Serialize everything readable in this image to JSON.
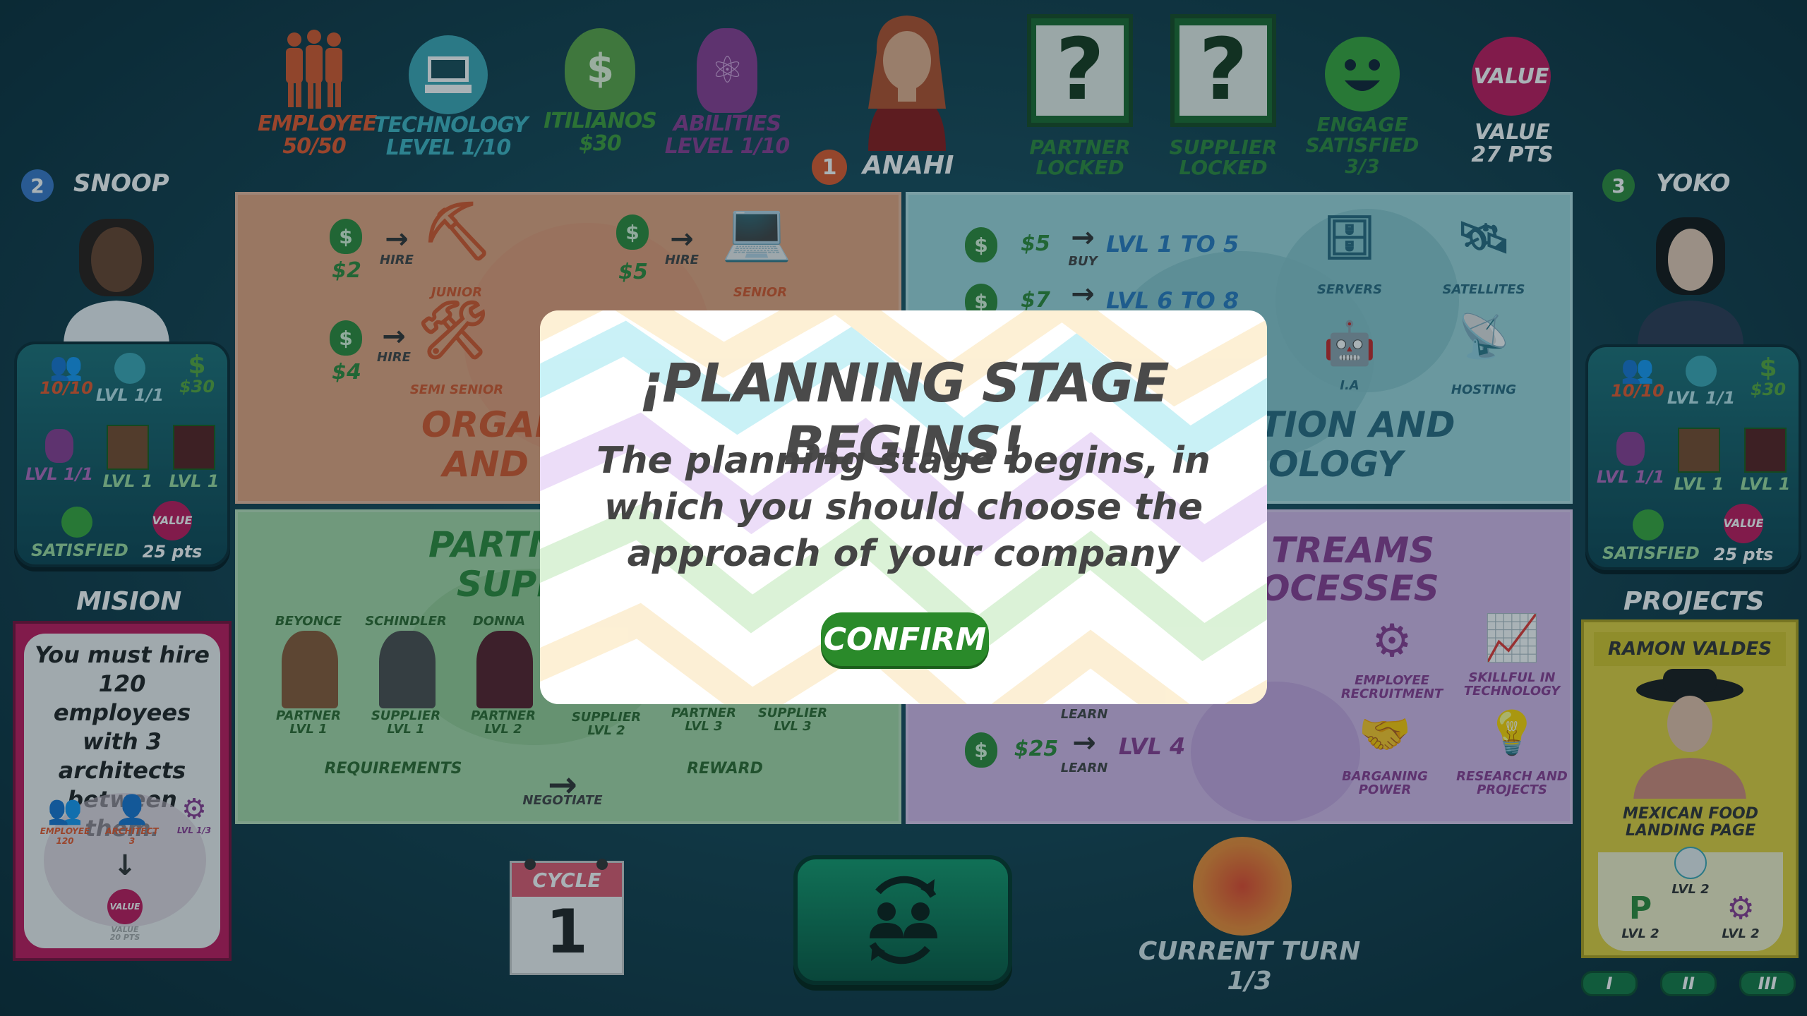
{
  "topbar": {
    "employee": {
      "label": "EMPLOYEE",
      "value": "50/50"
    },
    "technology": {
      "label": "TECHNOLOGY",
      "value": "LEVEL  1/10"
    },
    "itilianos": {
      "label": "ITILIANOS",
      "value": "$30"
    },
    "abilities": {
      "label": "ABILITIES",
      "value": "LEVEL  1/10"
    },
    "current_player": {
      "number": "1",
      "name": "ANAHI"
    },
    "partner": {
      "label": "PARTNER",
      "value": "LOCKED"
    },
    "supplier": {
      "label": "SUPPLIER",
      "value": "LOCKED"
    },
    "engage": {
      "label": "ENGAGE",
      "value": "SATISFIED",
      "sub": "3/3"
    },
    "value": {
      "badge": "VALUE",
      "label": "VALUE",
      "value": "27 PTS"
    }
  },
  "players": {
    "left": {
      "number": "2",
      "name": "SNOOP",
      "employees": "10/10",
      "tech": "LVL 1/1",
      "money": "$30",
      "ability": "LVL 1/1",
      "partner": "LVL 1",
      "supplier": "LVL 1",
      "satisfied": "SATISFIED",
      "value_badge": "VALUE",
      "value": "25 pts"
    },
    "right": {
      "number": "3",
      "name": "YOKO",
      "employees": "10/10",
      "tech": "LVL 1/1",
      "money": "$30",
      "ability": "LVL 1/1",
      "partner": "LVL 1",
      "supplier": "LVL 1",
      "satisfied": "SATISFIED",
      "value_badge": "VALUE",
      "value": "25 pts"
    }
  },
  "mission": {
    "heading": "MISION",
    "text": "You must hire 120 employees with 3 architects between them.",
    "employee_label": "EMPLOYEE",
    "employee_count": "120",
    "architect_label": "ARCHITECT",
    "architect_count": "3",
    "level": "LVL 1/3",
    "value_badge": "VALUE",
    "value_label": "VALUE",
    "value_pts": "20 PTS"
  },
  "projects": {
    "heading": "PROJECTS",
    "card_name": "RAMON VALDES",
    "card_project": "MEXICAN FOOD LANDING PAGE",
    "req1": "LVL 2",
    "req2": "LVL 2",
    "req3": "LVL 2",
    "tabs": [
      "I",
      "II",
      "III"
    ]
  },
  "org": {
    "cost1": "$2",
    "action1": "HIRE",
    "role1": "JUNIOR",
    "cost2": "$5",
    "action2": "HIRE",
    "role2": "SENIOR",
    "cost3": "$4",
    "action3": "HIRE",
    "role3": "SEMI SENIOR",
    "title_a": "ORGANI",
    "title_b": "AND P"
  },
  "tech": {
    "cost1": "$5",
    "action1": "BUY",
    "range1": "LVL 1 TO 5",
    "cost2": "$7",
    "range2": "LVL 6 TO 8",
    "servers": "SERVERS",
    "satellites": "SATELLITES",
    "ia": "I.A",
    "hosting": "HOSTING",
    "title_a": "TION AND",
    "title_b": "OLOGY"
  },
  "partners": {
    "title_a": "PARTN",
    "title_b": "SUPP",
    "names": [
      "BEYONCE",
      "SCHINDLER",
      "DONNA"
    ],
    "cards": [
      {
        "type": "PARTNER",
        "level": "LVL 1"
      },
      {
        "type": "SUPPLIER",
        "level": "LVL 1"
      },
      {
        "type": "PARTNER",
        "level": "LVL 2"
      },
      {
        "type": "SUPPLIER",
        "level": "LVL 2"
      },
      {
        "type": "PARTNER",
        "level": "LVL 3"
      },
      {
        "type": "SUPPLIER",
        "level": "LVL 3"
      }
    ],
    "requirements": "REQUIREMENTS",
    "negotiate": "NEGOTIATE",
    "reward": "REWARD"
  },
  "streams": {
    "title_a": "TREAMS",
    "title_b": "OCESSES",
    "learn1": "LEARN",
    "cost2": "$25",
    "learn2": "LEARN",
    "level": "LVL 4",
    "recruitment": "EMPLOYEE RECRUITMENT",
    "skillful": "SKILLFUL IN TECHNOLOGY",
    "bargaining": "BARGANING POWER",
    "research": "RESEARCH AND PROJECTS"
  },
  "bottom": {
    "cycle_label": "CYCLE",
    "cycle_value": "1",
    "turn_label": "CURRENT TURN",
    "turn_value": "1/3"
  },
  "modal": {
    "title": "¡PLANNING STAGE BEGINS!",
    "body": "The planning stage begins, in which you should choose the approach of your company",
    "confirm": "CONFIRM"
  },
  "colors": {
    "accent_green": "#2a8a2a",
    "org": "#e7a57e",
    "tech": "#9fd8dc",
    "partners": "#a8d9a6",
    "streams": "#d7b9ea",
    "value_pink": "#c2185b"
  }
}
